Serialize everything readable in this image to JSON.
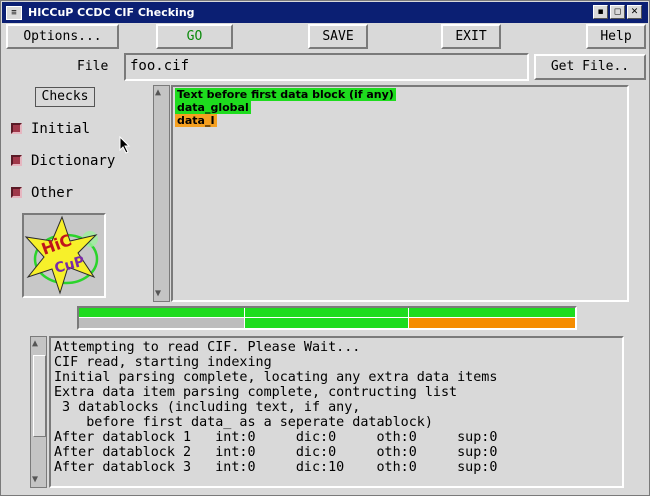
{
  "window": {
    "title": "HICCuP  CCDC CIF Checking",
    "title_buttons": [
      "▪",
      "◻",
      "✕"
    ]
  },
  "toolbar": {
    "options_label": "Options...",
    "go_label": "GO",
    "save_label": "SAVE",
    "exit_label": "EXIT",
    "help_label": "Help"
  },
  "file": {
    "label": "File",
    "value": "foo.cif",
    "get_file_label": "Get File.."
  },
  "checks": {
    "title": "Checks",
    "items": [
      {
        "label": "Initial",
        "checked": true
      },
      {
        "label": "Dictionary",
        "checked": true
      },
      {
        "label": "Other",
        "checked": true
      }
    ]
  },
  "logo": {
    "text_top": "HiC",
    "text_bottom": "CuP"
  },
  "datablocks": [
    {
      "label": "Text before first data block (if any)",
      "color": "#1edc1e"
    },
    {
      "label": "data_global",
      "color": "#1edc1e"
    },
    {
      "label": "data_I",
      "color": "#f5a020"
    }
  ],
  "status_strip": {
    "colors": {
      "green": "#1edc1e",
      "grey": "#bdbdbd",
      "orange": "#f58c00"
    }
  },
  "log": [
    "Attempting to read CIF. Please Wait...",
    "CIF read, starting indexing",
    "Initial parsing complete, locating any extra data items",
    "Extra data item parsing complete, contructing list",
    " 3 datablocks (including text, if any,",
    "    before first data_ as a seperate datablock)",
    "After datablock 1   int:0     dic:0     oth:0     sup:0",
    "After datablock 2   int:0     dic:0     oth:0     sup:0",
    "After datablock 3   int:0     dic:10    oth:0     sup:0"
  ]
}
